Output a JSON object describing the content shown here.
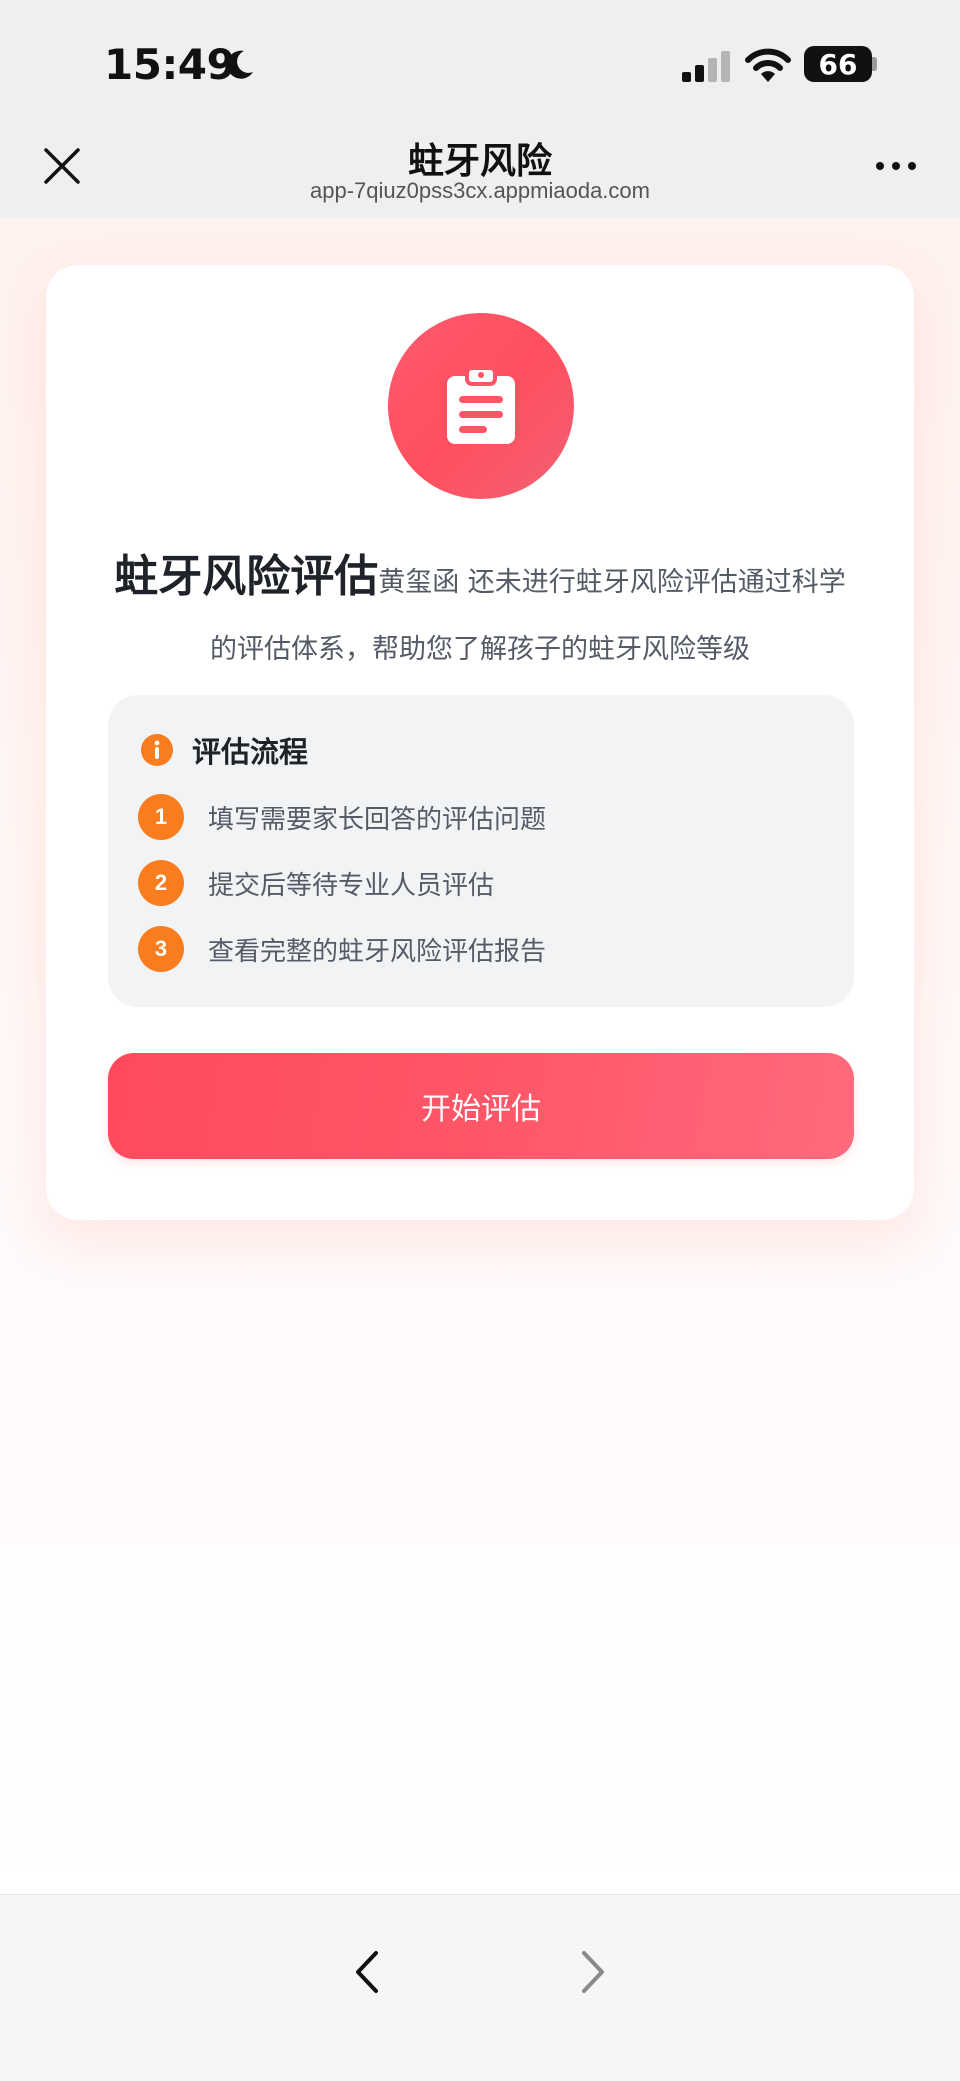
{
  "status_bar": {
    "time": "15:49",
    "battery": "66"
  },
  "nav": {
    "title": "蛀牙风险",
    "url": "app-7qiuz0pss3cx.appmiaoda.com"
  },
  "card": {
    "title": "蛀牙风险评估",
    "description": "黄玺函 还未进行蛀牙风险评估通过科学的评估体系，帮助您了解孩子的蛀牙风险等级",
    "process": {
      "title": "评估流程",
      "steps": [
        {
          "num": "1",
          "text": "填写需要家长回答的评估问题"
        },
        {
          "num": "2",
          "text": "提交后等待专业人员评估"
        },
        {
          "num": "3",
          "text": "查看完整的蛀牙风险评估报告"
        }
      ]
    },
    "start_label": "开始评估"
  },
  "colors": {
    "accent": "#ff4f5e",
    "step_badge": "#f97c1f"
  },
  "icons": {
    "hero": "clipboard-icon",
    "close": "close-icon",
    "more": "more-icon",
    "info": "info-icon",
    "back": "back-icon",
    "forward": "forward-icon"
  }
}
